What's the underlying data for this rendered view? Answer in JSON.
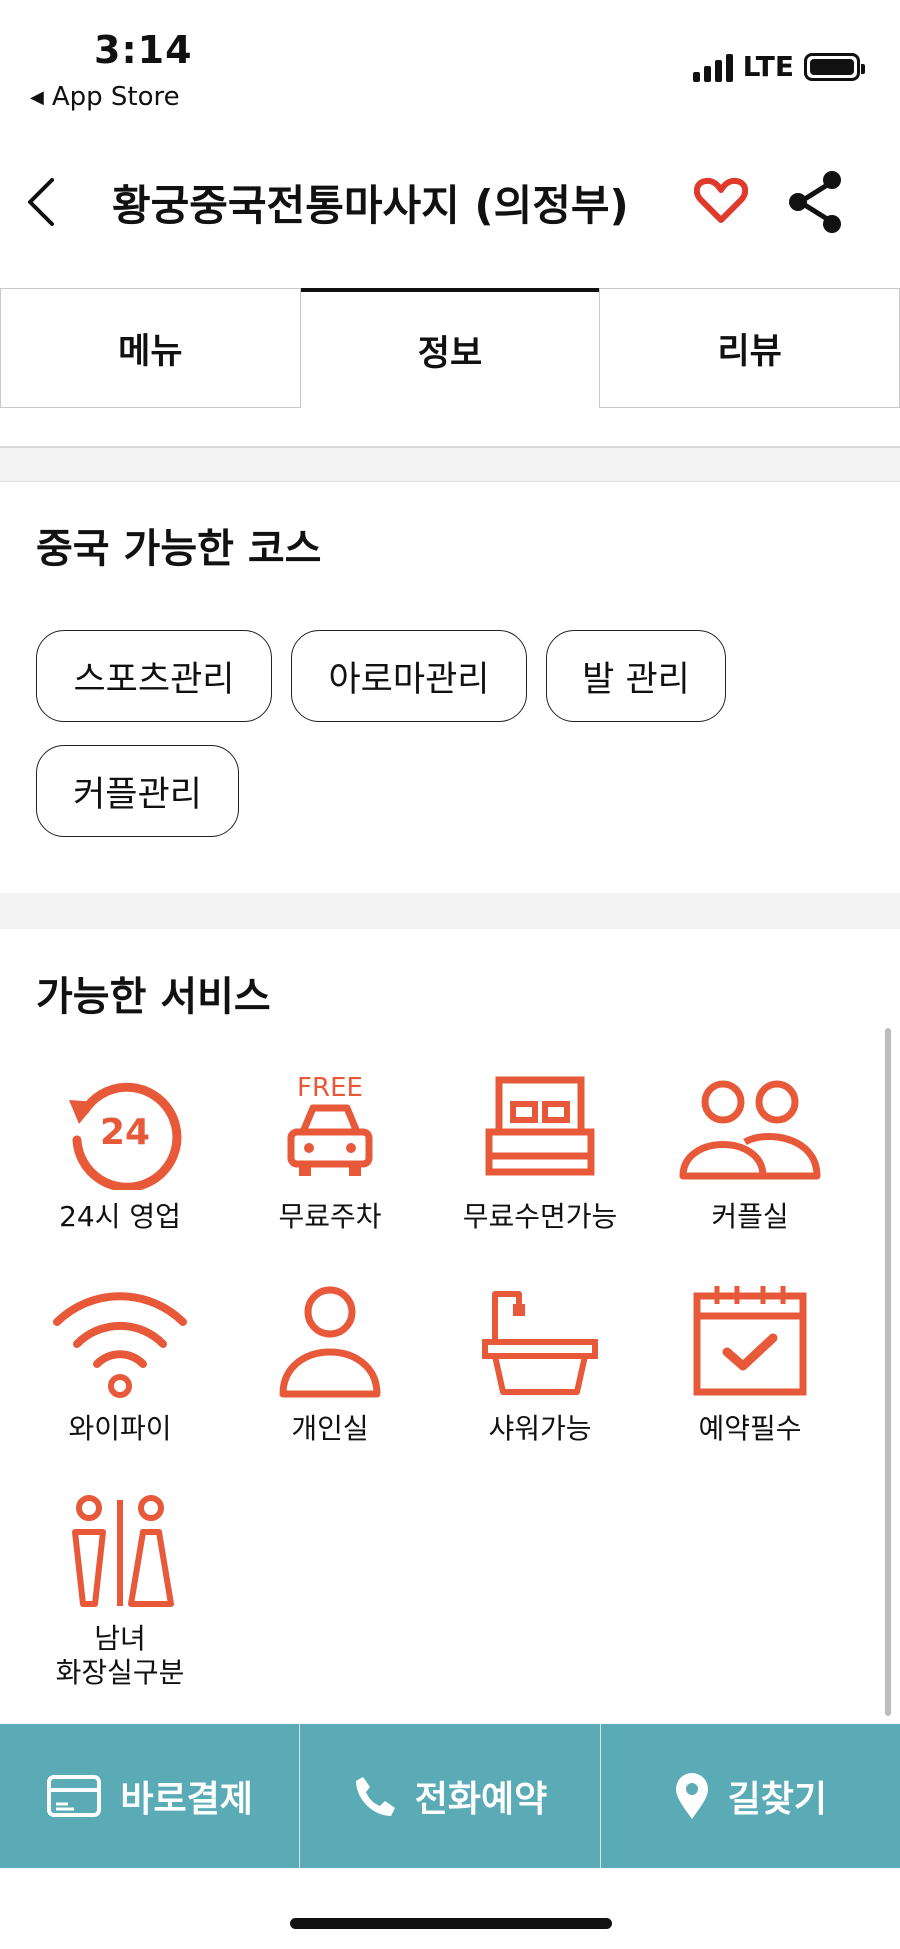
{
  "status_bar": {
    "time": "3:14",
    "back_app": "App Store",
    "network": "LTE"
  },
  "header": {
    "title": "황궁중국전통마사지 (의정부)",
    "heart_color": "#e03a2c"
  },
  "tabs": [
    {
      "label": "메뉴",
      "active": false
    },
    {
      "label": "정보",
      "active": true
    },
    {
      "label": "리뷰",
      "active": false
    }
  ],
  "courses": {
    "title": "중국 가능한 코스",
    "items": [
      "스포츠관리",
      "아로마관리",
      "발 관리",
      "커플관리"
    ]
  },
  "services": {
    "title": "가능한 서비스",
    "icon_color": "#e8593a",
    "items": [
      {
        "icon": "24-hour-icon",
        "label": "24시 영업"
      },
      {
        "icon": "free-parking-icon",
        "label": "무료주차",
        "icon_text": "FREE"
      },
      {
        "icon": "bed-icon",
        "label": "무료수면가능"
      },
      {
        "icon": "couple-icon",
        "label": "커플실"
      },
      {
        "icon": "wifi-icon",
        "label": "와이파이"
      },
      {
        "icon": "person-icon",
        "label": "개인실"
      },
      {
        "icon": "bathtub-icon",
        "label": "샤워가능"
      },
      {
        "icon": "calendar-check-icon",
        "label": "예약필수"
      },
      {
        "icon": "restroom-icon",
        "label": "남녀",
        "label2": "화장실구분"
      }
    ]
  },
  "bottom_bar": {
    "bg_color": "#5aabb6",
    "pay": "바로결제",
    "call": "전화예약",
    "directions": "길찾기"
  }
}
